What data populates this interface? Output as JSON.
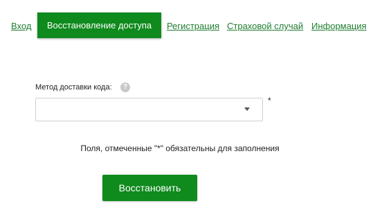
{
  "tabs": [
    {
      "label": "Вход",
      "active": false
    },
    {
      "label": "Восстановление доступа",
      "active": true
    },
    {
      "label": "Регистрация",
      "active": false
    },
    {
      "label": "Страховой случай",
      "active": false
    },
    {
      "label": "Информация",
      "active": false
    }
  ],
  "form": {
    "delivery_label": "Метод доставки кода:",
    "help_icon": "question-icon",
    "help_glyph": "?",
    "delivery_value": "",
    "required_mark": "*",
    "required_note": "Поля, отмеченные \"*\" обязательны для заполнения",
    "submit_label": "Восстановить"
  },
  "colors": {
    "accent": "#0f8a1d",
    "link": "#1e7c2f"
  }
}
